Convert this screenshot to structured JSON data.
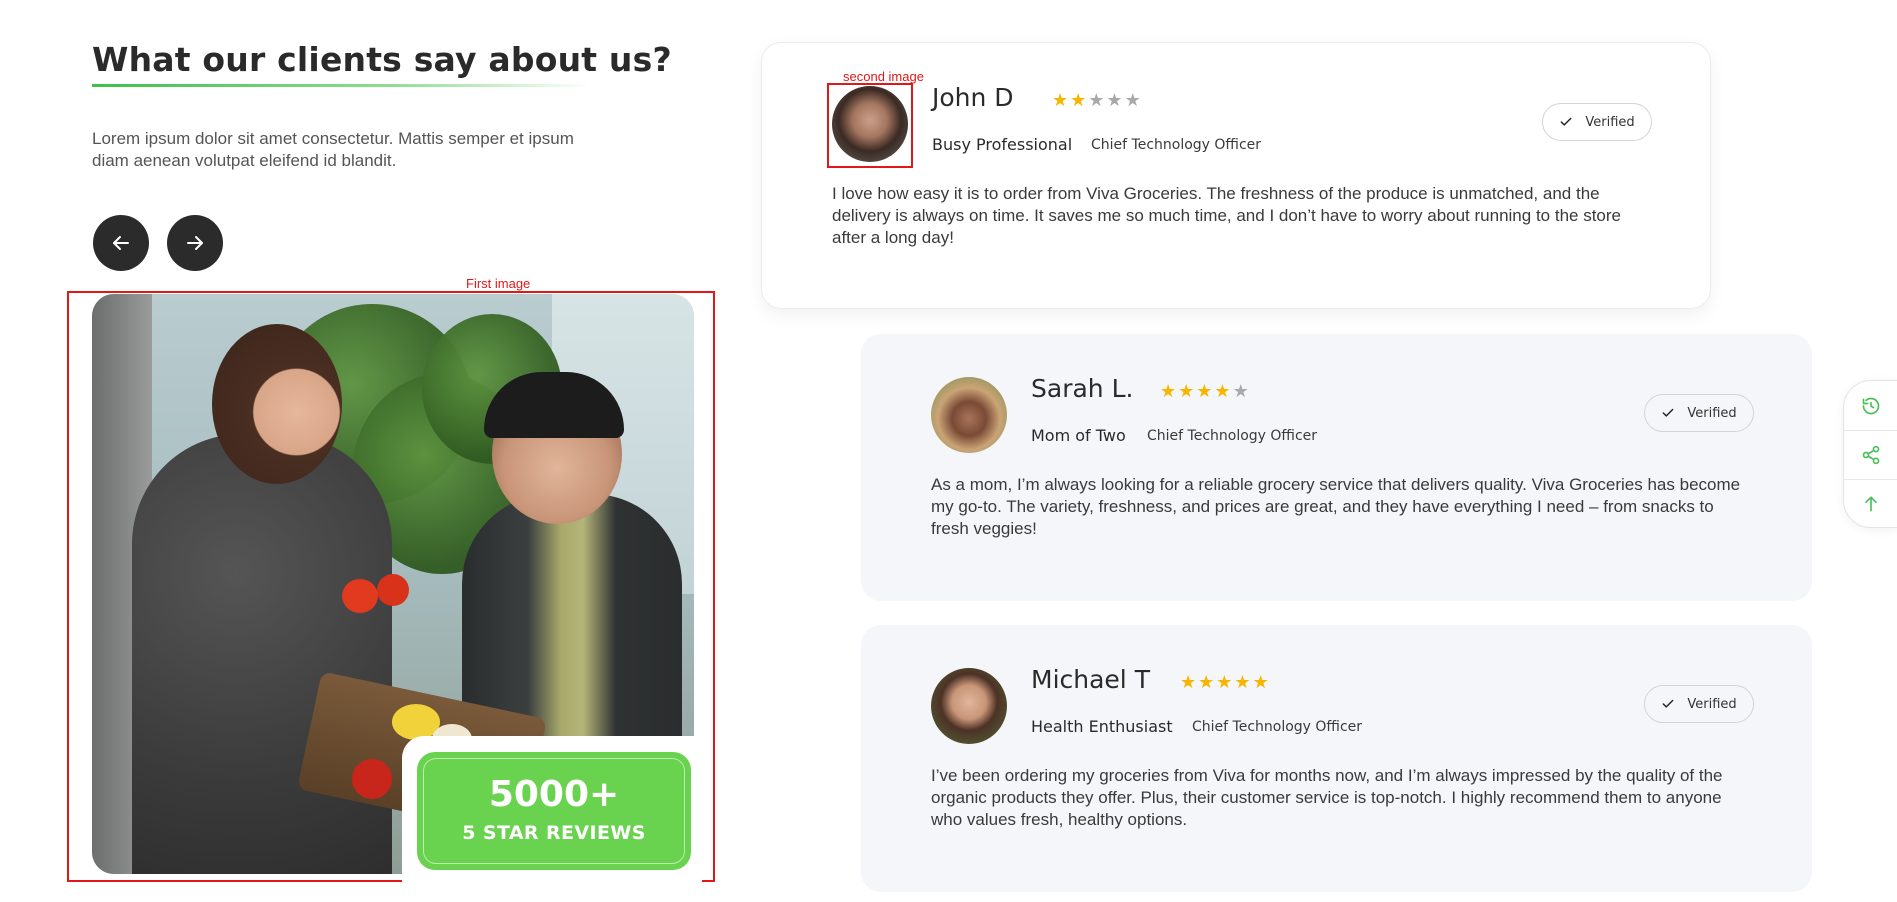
{
  "section": {
    "title": "What our clients say about us?",
    "intro": "Lorem ipsum dolor sit amet consectetur. Mattis semper et ipsum diam aenean volutpat eleifend id blandit."
  },
  "nav": {
    "prev_icon": "arrow-left-icon",
    "next_icon": "arrow-right-icon"
  },
  "annotations": {
    "first_image_label": "First image",
    "second_image_label": "second image",
    "color": "#e01818"
  },
  "badge": {
    "count": "5000+",
    "label": "5 STAR REVIEWS",
    "color": "#69d24f"
  },
  "reviews": [
    {
      "name": "John D",
      "rating": 2,
      "max_rating": 5,
      "role": "Busy Professional",
      "position": "Chief Technology Officer",
      "verified": "Verified",
      "text": "I love how easy it is to order from Viva Groceries. The freshness of the produce is unmatched, and the delivery is always on time. It saves me so much time, and I don’t have to worry about running to the store after a long day!"
    },
    {
      "name": "Sarah L.",
      "rating": 4,
      "max_rating": 5,
      "role": "Mom of Two",
      "position": "Chief Technology Officer",
      "verified": "Verified",
      "text": "As a mom, I’m always looking for a reliable grocery service that delivers quality. Viva Groceries has become my go-to. The variety, freshness, and prices are great, and they have everything I need – from snacks to fresh veggies!"
    },
    {
      "name": "Michael T",
      "rating": 5,
      "max_rating": 5,
      "role": "Health Enthusiast",
      "position": "Chief Technology Officer",
      "verified": "Verified",
      "text": "I’ve been ordering my groceries from Viva for months now, and I’m always impressed by the quality of the organic products they offer. Plus, their customer service is top-notch. I highly recommend them to anyone who values fresh, healthy options."
    }
  ],
  "colors": {
    "star_on": "#f7b500",
    "star_off": "#a9a9a9",
    "accent_green": "#3cc04a",
    "dark_button": "#2b2b2b"
  },
  "toolbar": {
    "items": [
      "history-icon",
      "share-icon",
      "arrow-up-icon"
    ]
  }
}
